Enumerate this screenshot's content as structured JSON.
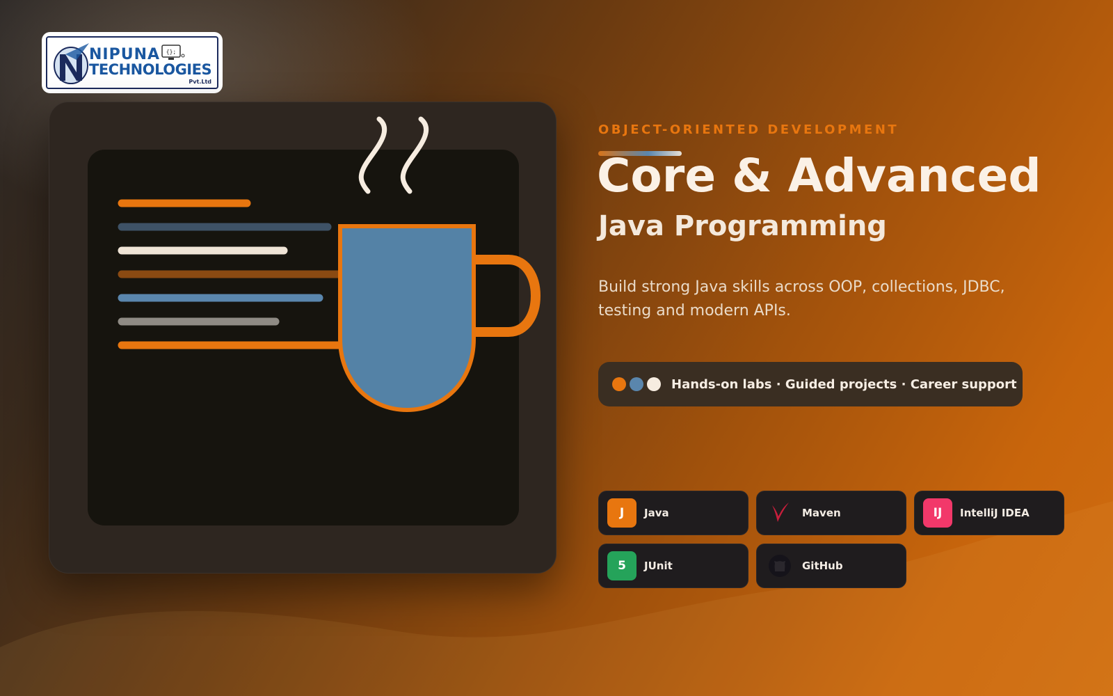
{
  "brand": {
    "line1": "NIPUNA",
    "line2": "TECHNOLOGIES",
    "suffix": "Pvt.Ltd",
    "monitor_glyph": "{};"
  },
  "hero": {
    "eyebrow": "OBJECT-ORIENTED DEVELOPMENT",
    "title": "Core & Advanced",
    "subtitle": "Java Programming",
    "description": "Build strong Java skills across OOP, collections, JDBC, testing and modern APIs.",
    "highlights": "Hands-on labs · Guided projects · Career support"
  },
  "tools": [
    {
      "label": "Java",
      "icon_text": "J",
      "icon": "java-icon",
      "color": "#e8760f"
    },
    {
      "label": "Maven",
      "icon_text": "",
      "icon": "maven-feather-icon",
      "color": "#c81e3c"
    },
    {
      "label": "IntelliJ IDEA",
      "icon_text": "IJ",
      "icon": "intellij-icon",
      "color": "#f2386a"
    },
    {
      "label": "JUnit",
      "icon_text": "5",
      "icon": "junit-icon",
      "color": "#25a35a"
    },
    {
      "label": "GitHub",
      "icon_text": "",
      "icon": "github-icon",
      "color": "#1f1c1e"
    }
  ],
  "colors": {
    "accent_orange": "#e8760f",
    "accent_blue": "#5a86ad",
    "cream": "#f4e9dc",
    "card": "#2e2620",
    "screen": "#16140e"
  }
}
